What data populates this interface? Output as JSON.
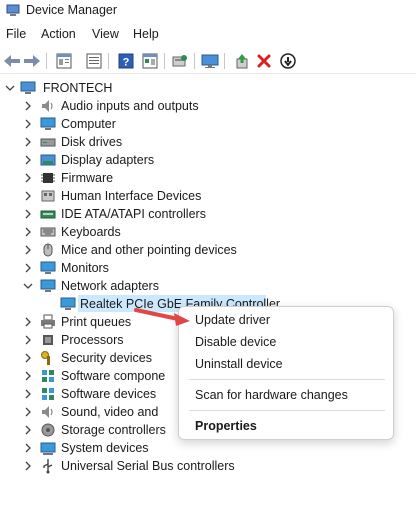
{
  "window": {
    "title": "Device Manager"
  },
  "menu": [
    "File",
    "Action",
    "View",
    "Help"
  ],
  "toolbar": {
    "icons": [
      "back-icon",
      "forward-icon",
      "properties-icon",
      "details-icon",
      "help-icon",
      "show-hidden-icon",
      "scan-hardware-icon",
      "monitor-icon",
      "add-driver-icon",
      "uninstall-icon",
      "disable-icon"
    ]
  },
  "tree": {
    "root": "FRONTECH",
    "items": [
      "Audio inputs and outputs",
      "Computer",
      "Disk drives",
      "Display adapters",
      "Firmware",
      "Human Interface Devices",
      "IDE ATA/ATAPI controllers",
      "Keyboards",
      "Mice and other pointing devices",
      "Monitors",
      "Network adapters",
      "Realtek PCIe GbE Family Controller",
      "Print queues",
      "Processors",
      "Security devices",
      "Software compone",
      "Software devices",
      "Sound, video and",
      "Storage controllers",
      "System devices",
      "Universal Serial Bus controllers"
    ]
  },
  "context_menu": {
    "items": [
      "Update driver",
      "Disable device",
      "Uninstall device",
      "Scan for hardware changes",
      "Properties"
    ]
  },
  "colors": {
    "selection": "#cce8ff",
    "arrow": "#e04848",
    "delete_red": "#d92020",
    "help_blue": "#2f5eb5"
  }
}
